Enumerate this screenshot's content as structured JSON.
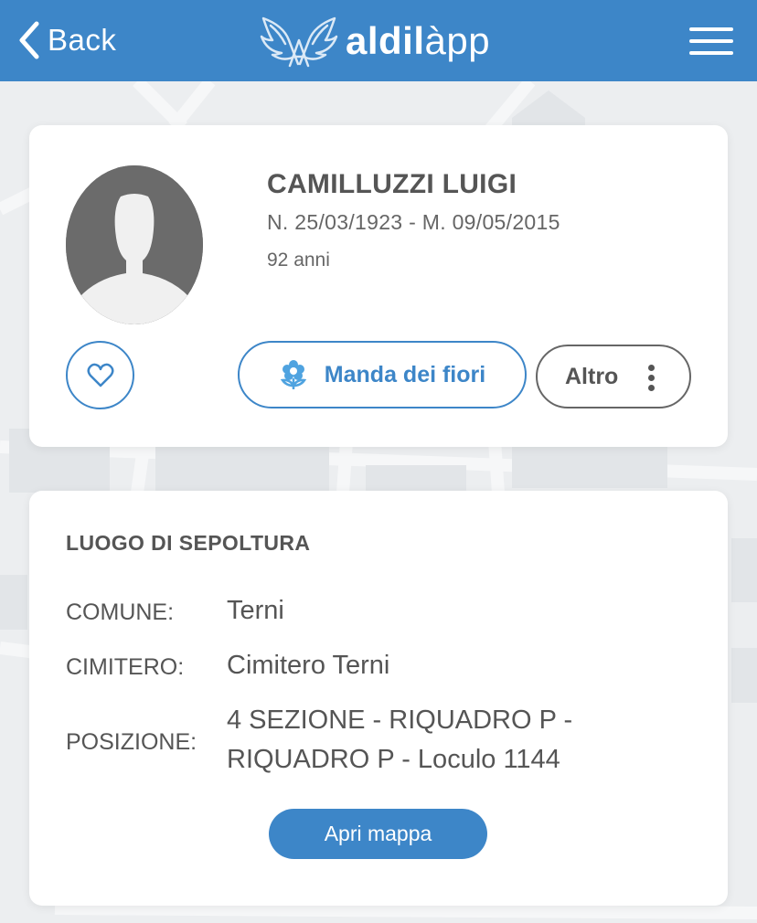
{
  "header": {
    "back_label": "Back",
    "logo_text_bold": "aldil",
    "logo_text_light": "àpp",
    "menu_icon": "hamburger-menu-icon",
    "background_color": "#3d86c8"
  },
  "profile": {
    "avatar_icon": "default-person-avatar",
    "name": "CAMILLUZZI LUIGI",
    "dates": "N. 25/03/1923 - M. 09/05/2015",
    "age": "92 anni",
    "favorite_icon": "heart-icon",
    "flowers_button": {
      "label": "Manda dei fiori",
      "icon": "flower-icon"
    },
    "more_button": {
      "label": "Altro",
      "icon": "vertical-dots-icon"
    }
  },
  "burial": {
    "title": "LUOGO DI SEPOLTURA",
    "comune_label": "COMUNE:",
    "comune_value": "Terni",
    "cimitero_label": "CIMITERO:",
    "cimitero_value": "Cimitero Terni",
    "posizione_label": "POSIZIONE:",
    "posizione_value_line1": "4 SEZIONE - RIQUADRO P -",
    "posizione_value_line2": "RIQUADRO P - Loculo 1144",
    "map_button_label": "Apri mappa"
  },
  "colors": {
    "accent": "#3d86c8",
    "text": "#555555",
    "page_background": "#eceef0"
  }
}
